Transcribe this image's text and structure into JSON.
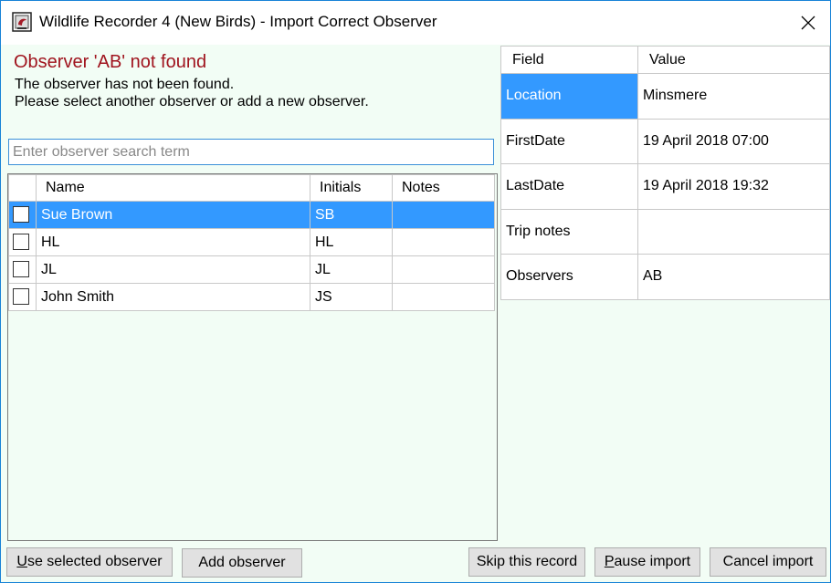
{
  "window": {
    "title": "Wildlife Recorder 4 (New Birds) - Import Correct Observer",
    "close_glyph": "✕"
  },
  "message": {
    "heading": "Observer 'AB' not found",
    "line1": "The observer has not been found.",
    "line2": "Please select another observer or add a new observer."
  },
  "search": {
    "placeholder": "Enter observer search term",
    "value": ""
  },
  "observers": {
    "columns": [
      "Name",
      "Initials",
      "Notes"
    ],
    "rows": [
      {
        "name": "Sue Brown",
        "initials": "SB",
        "notes": "",
        "selected": true
      },
      {
        "name": "HL",
        "initials": "HL",
        "notes": "",
        "selected": false
      },
      {
        "name": "JL",
        "initials": "JL",
        "notes": "",
        "selected": false
      },
      {
        "name": "John Smith",
        "initials": "JS",
        "notes": "",
        "selected": false
      }
    ]
  },
  "properties": {
    "columns": [
      "Field",
      "Value"
    ],
    "rows": [
      {
        "field": "Location",
        "value": "Minsmere"
      },
      {
        "field": "FirstDate",
        "value": "19 April 2018 07:00"
      },
      {
        "field": "LastDate",
        "value": "19 April 2018 19:32"
      },
      {
        "field": "Trip notes",
        "value": ""
      },
      {
        "field": "Observers",
        "value": "AB"
      }
    ]
  },
  "buttons": {
    "use_selected": {
      "mnemonic": "U",
      "rest": "se selected observer"
    },
    "add_observer": "Add observer",
    "skip_record": "Skip this record",
    "pause_import": {
      "mnemonic": "P",
      "rest": "ause import"
    },
    "cancel_import": "Cancel import"
  },
  "colors": {
    "selection": "#3399ff",
    "heading_red": "#a0141e",
    "form_background": "#f2fdf5"
  }
}
